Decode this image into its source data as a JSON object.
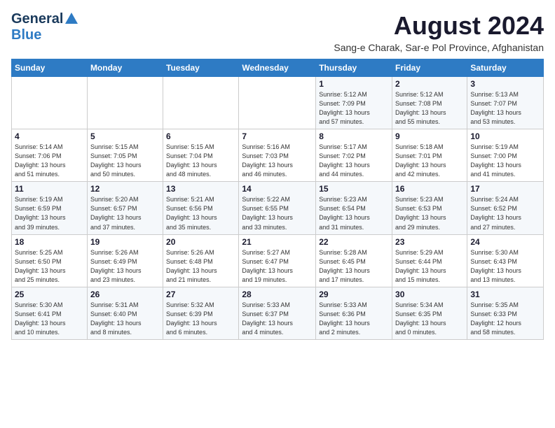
{
  "header": {
    "logo_line1": "General",
    "logo_line2": "Blue",
    "title": "August 2024",
    "subtitle": "Sang-e Charak, Sar-e Pol Province, Afghanistan"
  },
  "weekdays": [
    "Sunday",
    "Monday",
    "Tuesday",
    "Wednesday",
    "Thursday",
    "Friday",
    "Saturday"
  ],
  "weeks": [
    [
      {
        "day": "",
        "info": ""
      },
      {
        "day": "",
        "info": ""
      },
      {
        "day": "",
        "info": ""
      },
      {
        "day": "",
        "info": ""
      },
      {
        "day": "1",
        "info": "Sunrise: 5:12 AM\nSunset: 7:09 PM\nDaylight: 13 hours\nand 57 minutes."
      },
      {
        "day": "2",
        "info": "Sunrise: 5:12 AM\nSunset: 7:08 PM\nDaylight: 13 hours\nand 55 minutes."
      },
      {
        "day": "3",
        "info": "Sunrise: 5:13 AM\nSunset: 7:07 PM\nDaylight: 13 hours\nand 53 minutes."
      }
    ],
    [
      {
        "day": "4",
        "info": "Sunrise: 5:14 AM\nSunset: 7:06 PM\nDaylight: 13 hours\nand 51 minutes."
      },
      {
        "day": "5",
        "info": "Sunrise: 5:15 AM\nSunset: 7:05 PM\nDaylight: 13 hours\nand 50 minutes."
      },
      {
        "day": "6",
        "info": "Sunrise: 5:15 AM\nSunset: 7:04 PM\nDaylight: 13 hours\nand 48 minutes."
      },
      {
        "day": "7",
        "info": "Sunrise: 5:16 AM\nSunset: 7:03 PM\nDaylight: 13 hours\nand 46 minutes."
      },
      {
        "day": "8",
        "info": "Sunrise: 5:17 AM\nSunset: 7:02 PM\nDaylight: 13 hours\nand 44 minutes."
      },
      {
        "day": "9",
        "info": "Sunrise: 5:18 AM\nSunset: 7:01 PM\nDaylight: 13 hours\nand 42 minutes."
      },
      {
        "day": "10",
        "info": "Sunrise: 5:19 AM\nSunset: 7:00 PM\nDaylight: 13 hours\nand 41 minutes."
      }
    ],
    [
      {
        "day": "11",
        "info": "Sunrise: 5:19 AM\nSunset: 6:59 PM\nDaylight: 13 hours\nand 39 minutes."
      },
      {
        "day": "12",
        "info": "Sunrise: 5:20 AM\nSunset: 6:57 PM\nDaylight: 13 hours\nand 37 minutes."
      },
      {
        "day": "13",
        "info": "Sunrise: 5:21 AM\nSunset: 6:56 PM\nDaylight: 13 hours\nand 35 minutes."
      },
      {
        "day": "14",
        "info": "Sunrise: 5:22 AM\nSunset: 6:55 PM\nDaylight: 13 hours\nand 33 minutes."
      },
      {
        "day": "15",
        "info": "Sunrise: 5:23 AM\nSunset: 6:54 PM\nDaylight: 13 hours\nand 31 minutes."
      },
      {
        "day": "16",
        "info": "Sunrise: 5:23 AM\nSunset: 6:53 PM\nDaylight: 13 hours\nand 29 minutes."
      },
      {
        "day": "17",
        "info": "Sunrise: 5:24 AM\nSunset: 6:52 PM\nDaylight: 13 hours\nand 27 minutes."
      }
    ],
    [
      {
        "day": "18",
        "info": "Sunrise: 5:25 AM\nSunset: 6:50 PM\nDaylight: 13 hours\nand 25 minutes."
      },
      {
        "day": "19",
        "info": "Sunrise: 5:26 AM\nSunset: 6:49 PM\nDaylight: 13 hours\nand 23 minutes."
      },
      {
        "day": "20",
        "info": "Sunrise: 5:26 AM\nSunset: 6:48 PM\nDaylight: 13 hours\nand 21 minutes."
      },
      {
        "day": "21",
        "info": "Sunrise: 5:27 AM\nSunset: 6:47 PM\nDaylight: 13 hours\nand 19 minutes."
      },
      {
        "day": "22",
        "info": "Sunrise: 5:28 AM\nSunset: 6:45 PM\nDaylight: 13 hours\nand 17 minutes."
      },
      {
        "day": "23",
        "info": "Sunrise: 5:29 AM\nSunset: 6:44 PM\nDaylight: 13 hours\nand 15 minutes."
      },
      {
        "day": "24",
        "info": "Sunrise: 5:30 AM\nSunset: 6:43 PM\nDaylight: 13 hours\nand 13 minutes."
      }
    ],
    [
      {
        "day": "25",
        "info": "Sunrise: 5:30 AM\nSunset: 6:41 PM\nDaylight: 13 hours\nand 10 minutes."
      },
      {
        "day": "26",
        "info": "Sunrise: 5:31 AM\nSunset: 6:40 PM\nDaylight: 13 hours\nand 8 minutes."
      },
      {
        "day": "27",
        "info": "Sunrise: 5:32 AM\nSunset: 6:39 PM\nDaylight: 13 hours\nand 6 minutes."
      },
      {
        "day": "28",
        "info": "Sunrise: 5:33 AM\nSunset: 6:37 PM\nDaylight: 13 hours\nand 4 minutes."
      },
      {
        "day": "29",
        "info": "Sunrise: 5:33 AM\nSunset: 6:36 PM\nDaylight: 13 hours\nand 2 minutes."
      },
      {
        "day": "30",
        "info": "Sunrise: 5:34 AM\nSunset: 6:35 PM\nDaylight: 13 hours\nand 0 minutes."
      },
      {
        "day": "31",
        "info": "Sunrise: 5:35 AM\nSunset: 6:33 PM\nDaylight: 12 hours\nand 58 minutes."
      }
    ]
  ]
}
